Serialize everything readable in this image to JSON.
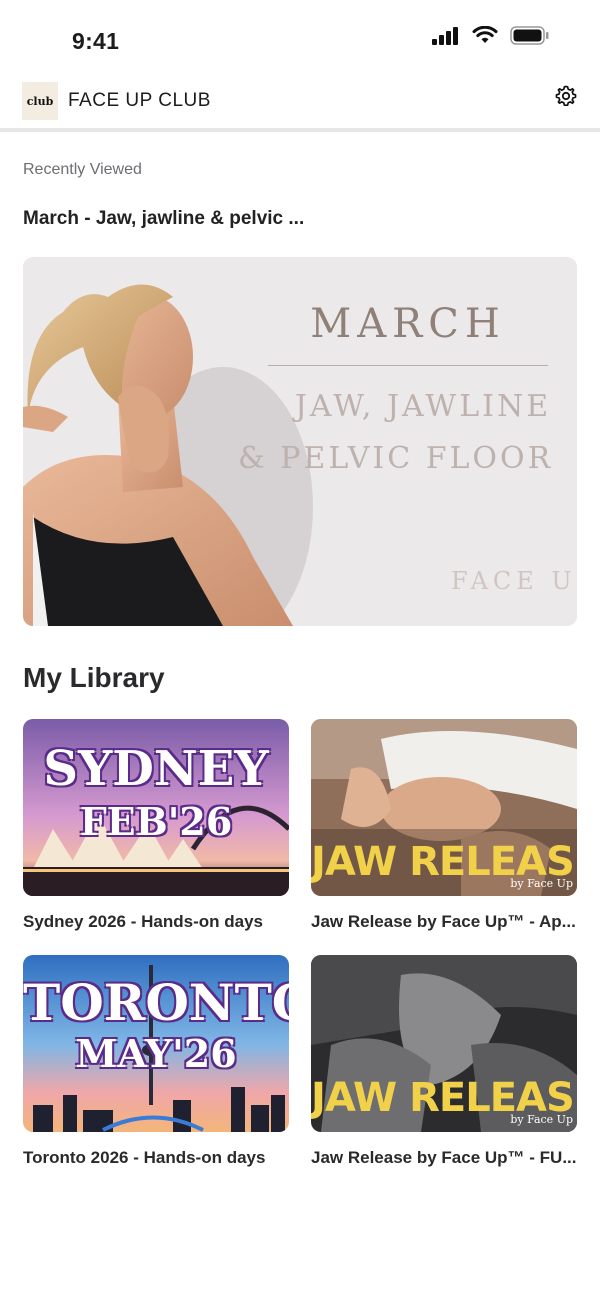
{
  "status_bar": {
    "time": "9:41"
  },
  "header": {
    "logo_text": "club",
    "app_title": "FACE UP CLUB"
  },
  "recently_viewed": {
    "section_label": "Recently Viewed",
    "title": "March - Jaw, jawline & pelvic ...",
    "hero": {
      "line1": "MARCH",
      "line2": "JAW, JAWLINE",
      "line3": "& PELVIC FLOOR",
      "brand": "FACE U"
    }
  },
  "library": {
    "title": "My Library",
    "items": [
      {
        "label": "Sydney 2026 - Hands-on days",
        "poster_line1": "SYDNEY",
        "poster_line2": "FEB'26"
      },
      {
        "label": "Jaw Release by Face Up™ - Ap...",
        "poster_line1": "JAW RELEASE",
        "poster_line2": "by Face Up"
      },
      {
        "label": "Toronto 2026 - Hands-on days",
        "poster_line1": "TORONTO",
        "poster_line2": "MAY'26"
      },
      {
        "label": "Jaw Release by Face Up™ - FU...",
        "poster_line1": "JAW RELEASE",
        "poster_line2": "by Face Up"
      }
    ]
  },
  "colors": {
    "accent_yellow": "#f2d14a",
    "hero_background": "#ece9ea",
    "header_divider": "#e6e6e8"
  },
  "icons": [
    "cellular-signal-icon",
    "wifi-icon",
    "battery-icon",
    "gear-icon"
  ]
}
